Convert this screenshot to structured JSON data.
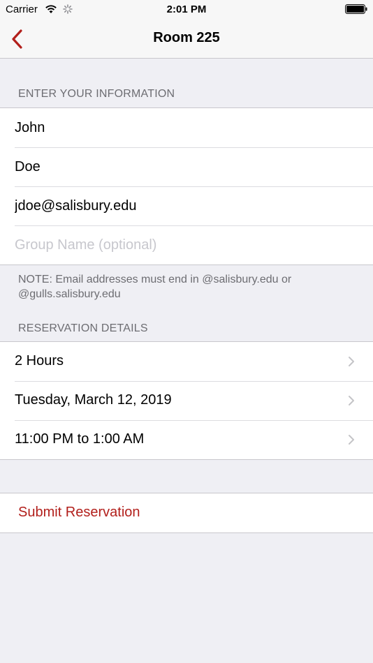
{
  "status_bar": {
    "carrier": "Carrier",
    "time": "2:01 PM",
    "icons": [
      "wifi-icon",
      "activity-spinner-icon",
      "battery-icon"
    ]
  },
  "nav": {
    "title": "Room 225",
    "back_icon": "chevron-left-icon"
  },
  "info_section": {
    "header": "ENTER YOUR INFORMATION",
    "fields": [
      {
        "value": "John",
        "placeholder": ""
      },
      {
        "value": "Doe",
        "placeholder": ""
      },
      {
        "value": "jdoe@salisbury.edu",
        "placeholder": ""
      },
      {
        "value": "",
        "placeholder": "Group Name (optional)"
      }
    ],
    "note": "NOTE: Email addresses must end in @salisbury.edu or @gulls.salisbury.edu"
  },
  "reservation_section": {
    "header": "RESERVATION DETAILS",
    "rows": [
      {
        "label": "2 Hours"
      },
      {
        "label": "Tuesday, March 12, 2019"
      },
      {
        "label": "11:00 PM to 1:00 AM"
      }
    ]
  },
  "submit": {
    "label": "Submit Reservation"
  },
  "colors": {
    "accent": "#b21f1b",
    "background": "#efeff4",
    "secondary_text": "#6d6d72",
    "chevron": "#c4c4c7"
  }
}
